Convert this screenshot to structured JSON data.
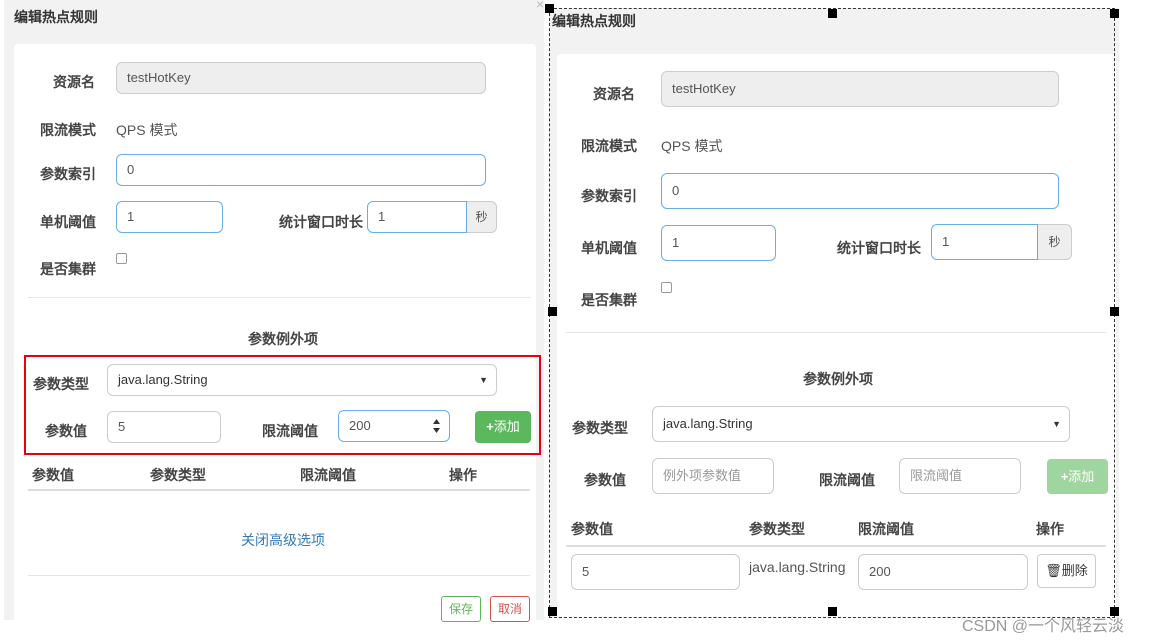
{
  "left": {
    "title": "编辑热点规则",
    "resource_label": "资源名",
    "resource_value": "testHotKey",
    "mode_label": "限流模式",
    "mode_value": "QPS 模式",
    "param_index_label": "参数索引",
    "param_index_value": "0",
    "threshold_label": "单机阈值",
    "threshold_value": "1",
    "window_label": "统计窗口时长",
    "window_value": "1",
    "window_unit": "秒",
    "cluster_label": "是否集群",
    "exception_title": "参数例外项",
    "param_type_label": "参数类型",
    "param_type_value": "java.lang.String",
    "param_value_label": "参数值",
    "param_value_value": "5",
    "limit_label": "限流阈值",
    "limit_value": "200",
    "add_label": "添加",
    "table_headers": [
      "参数值",
      "参数类型",
      "限流阈值",
      "操作"
    ],
    "close_advanced": "关闭高级选项",
    "save_label": "保存",
    "cancel_label": "取消"
  },
  "right": {
    "title": "编辑热点规则",
    "resource_label": "资源名",
    "resource_value": "testHotKey",
    "mode_label": "限流模式",
    "mode_value": "QPS 模式",
    "param_index_label": "参数索引",
    "param_index_value": "0",
    "threshold_label": "单机阈值",
    "threshold_value": "1",
    "window_label": "统计窗口时长",
    "window_value": "1",
    "window_unit": "秒",
    "cluster_label": "是否集群",
    "exception_title": "参数例外项",
    "param_type_label": "参数类型",
    "param_type_value": "java.lang.String",
    "param_value_label": "参数值",
    "param_value_placeholder": "例外项参数值",
    "limit_label": "限流阈值",
    "limit_placeholder": "限流阈值",
    "add_label": "添加",
    "table_headers": [
      "参数值",
      "参数类型",
      "限流阈值",
      "操作"
    ],
    "row": {
      "param_value": "5",
      "param_type": "java.lang.String",
      "limit": "200",
      "delete_label": "删除"
    }
  },
  "watermark": "CSDN @一个风轻云淡",
  "colors": {
    "accent_green": "#5cb85c",
    "highlight_red": "#e60012",
    "link_blue": "#337ab7",
    "focus_border": "#66afe9"
  },
  "icons": {
    "plus": "plus-icon",
    "trash": "trash-icon",
    "spinner": "spinner-arrows-icon",
    "close": "close-icon"
  }
}
